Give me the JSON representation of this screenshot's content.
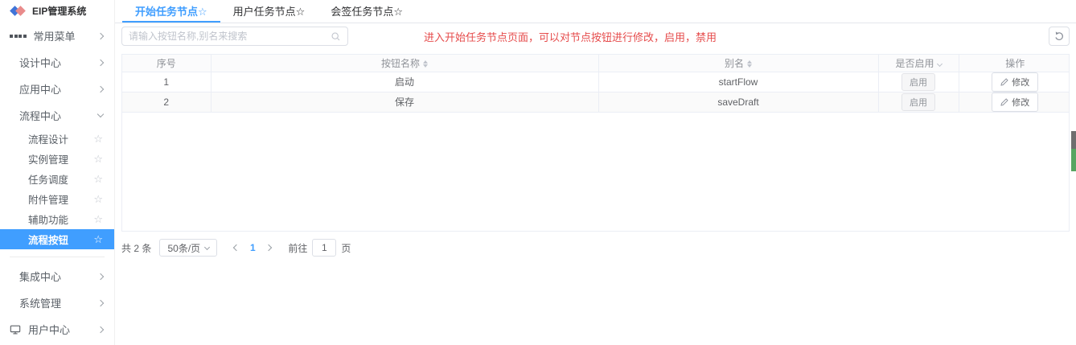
{
  "app": {
    "title": "EIP管理系统"
  },
  "colors": {
    "accent": "#409eff",
    "notice_red": "#e64c4c",
    "active_item_bg": "#409eff",
    "logo_blue": "#3f74d8",
    "logo_red": "#e98b8b",
    "edge_gray": "#6e6e6e",
    "edge_green": "#57a561"
  },
  "icons": {
    "star": "☆"
  },
  "sidebar": {
    "items": [
      {
        "label": "常用菜单"
      },
      {
        "label": "设计中心"
      },
      {
        "label": "应用中心"
      },
      {
        "label": "流程中心"
      },
      {
        "label": "流程设计"
      },
      {
        "label": "实例管理"
      },
      {
        "label": "任务调度"
      },
      {
        "label": "附件管理"
      },
      {
        "label": "辅助功能"
      },
      {
        "label": "流程按钮"
      },
      {
        "label": "集成中心"
      },
      {
        "label": "系统管理"
      },
      {
        "label": "用户中心"
      }
    ]
  },
  "tabs": [
    {
      "label": "开始任务节点☆",
      "active": true
    },
    {
      "label": "用户任务节点☆",
      "active": false
    },
    {
      "label": "会签任务节点☆",
      "active": false
    }
  ],
  "toolbar": {
    "search_placeholder": "请输入按钮名称,别名来搜索",
    "notice": "进入开始任务节点页面，可以对节点按钮进行修改，启用，禁用"
  },
  "table": {
    "columns": [
      {
        "label": "序号"
      },
      {
        "label": "按钮名称",
        "sortable": true
      },
      {
        "label": "别名",
        "sortable": true
      },
      {
        "label": "是否启用",
        "filterable": true
      },
      {
        "label": "操作"
      }
    ],
    "rows": [
      {
        "index": "1",
        "name": "启动",
        "alias": "startFlow",
        "enabled": "启用",
        "action": "修改"
      },
      {
        "index": "2",
        "name": "保存",
        "alias": "saveDraft",
        "enabled": "启用",
        "action": "修改"
      }
    ]
  },
  "pagination": {
    "total_label": "共 2 条",
    "page_size": "50条/页",
    "current_page": "1",
    "goto_label": "前往",
    "goto_value": "1",
    "page_unit": "页"
  }
}
